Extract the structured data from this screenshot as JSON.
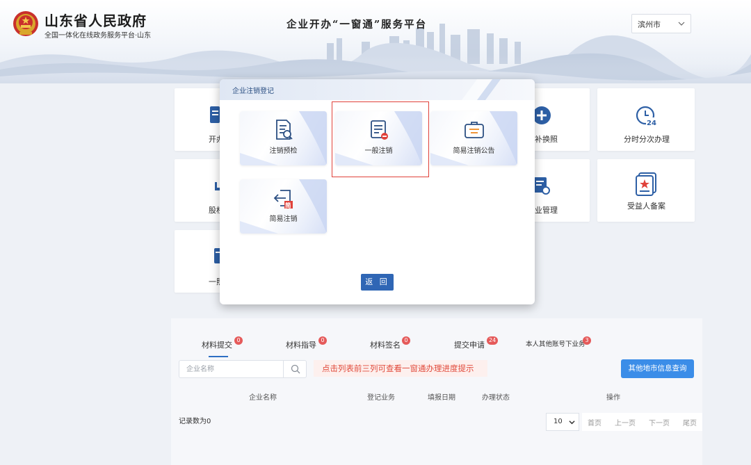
{
  "header": {
    "gov_title": "山东省人民政府",
    "gov_subtitle": "全国一体化在线政务服务平台·山东",
    "platform_title": "企业开办“一窗通”服务平台",
    "city": "滨州市"
  },
  "tiles": {
    "row1_left": "开办",
    "row1_right_partial": "补换照",
    "row1_far_right": "分时分次办理",
    "row2_left": "股权",
    "row2_right_partial": "业管理",
    "row2_far_right": "受益人备案",
    "row3_left": "一照"
  },
  "modal": {
    "title": "企业注销登记",
    "cards": [
      {
        "label": "注销预检",
        "icon": "document-search-icon"
      },
      {
        "label": "一般注销",
        "icon": "document-minus-icon"
      },
      {
        "label": "简易注销公告",
        "icon": "briefcase-icon"
      },
      {
        "label": "简易注销",
        "icon": "exit-simple-icon",
        "tag": "简"
      }
    ],
    "back_label": "返 回"
  },
  "bottom": {
    "tabs": [
      {
        "label": "材料提交",
        "count": "0"
      },
      {
        "label": "材料指导",
        "count": "0"
      },
      {
        "label": "材料签名",
        "count": "0"
      },
      {
        "label": "提交申请",
        "count": "24"
      },
      {
        "label": "本人其他账号下业务",
        "count": "3"
      }
    ],
    "search_placeholder": "企业名称",
    "hint": "点击列表前三列可查看一窗通办理进度提示",
    "query_button": "其他地市信息查询",
    "columns": [
      "企业名称",
      "登记业务",
      "填报日期",
      "办理状态",
      "操作"
    ],
    "record_count": "记录数为0",
    "page_size": "10",
    "pager": [
      "首页",
      "上一页",
      "下一页",
      "尾页"
    ]
  },
  "colors": {
    "accent": "#2f66b5",
    "badge": "#e55a5a",
    "highlight": "#e0413a",
    "query": "#3b8de8",
    "hint_text": "#e14a3b"
  }
}
